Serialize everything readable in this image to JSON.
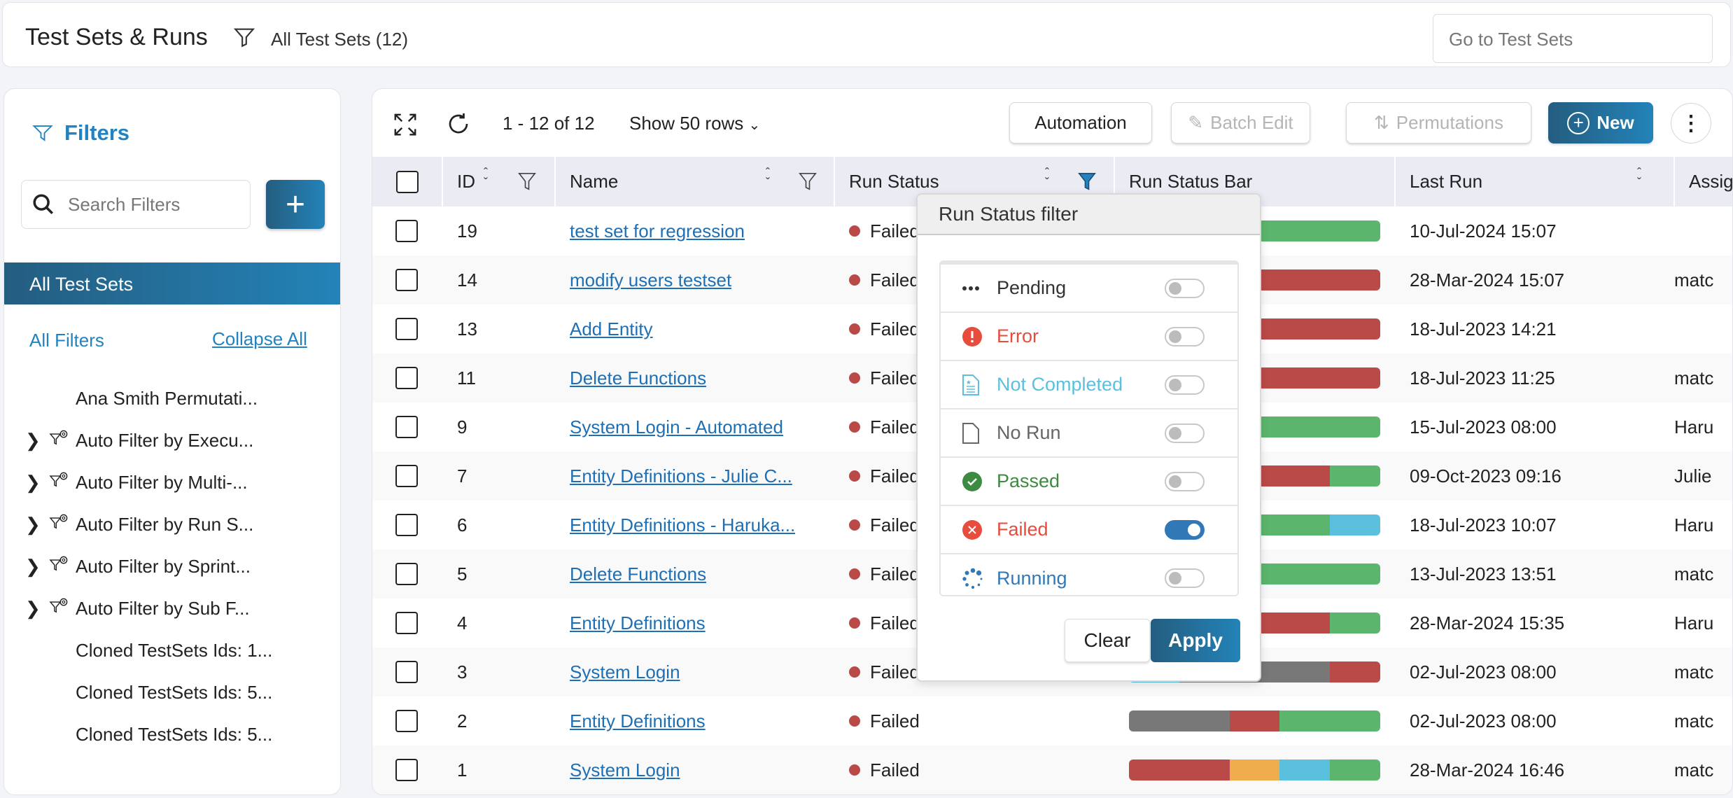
{
  "header": {
    "title": "Test Sets & Runs",
    "filter_label": "All Test Sets (12)",
    "goto_placeholder": "Go to Test Sets"
  },
  "sidebar": {
    "title": "Filters",
    "search_placeholder": "Search Filters",
    "add_label": "+",
    "selected": "All Test Sets",
    "all_filters": "All Filters",
    "collapse_all": "Collapse All",
    "items": [
      {
        "label": "Ana Smith Permutati...",
        "expandable": false,
        "auto": false
      },
      {
        "label": "Auto Filter by Execu...",
        "expandable": true,
        "auto": true
      },
      {
        "label": "Auto Filter by Multi-...",
        "expandable": true,
        "auto": true
      },
      {
        "label": "Auto Filter by Run S...",
        "expandable": true,
        "auto": true
      },
      {
        "label": "Auto Filter by Sprint...",
        "expandable": true,
        "auto": true
      },
      {
        "label": "Auto Filter by Sub F...",
        "expandable": true,
        "auto": true
      },
      {
        "label": "Cloned TestSets Ids: 1...",
        "expandable": false,
        "auto": false
      },
      {
        "label": "Cloned TestSets Ids: 5...",
        "expandable": false,
        "auto": false
      },
      {
        "label": "Cloned TestSets Ids: 5...",
        "expandable": false,
        "auto": false
      }
    ]
  },
  "toolbar": {
    "range": "1 - 12 of 12",
    "rows": "Show 50 rows",
    "automation": "Automation",
    "batch_edit": "Batch Edit",
    "permutations": "Permutations",
    "new": "New"
  },
  "colors": {
    "passed": "#5bb56d",
    "failed": "#b94a48",
    "norun": "#787878",
    "notcompleted": "#5bc0de",
    "error": "#f0ad4e",
    "accent": "#2383b8"
  },
  "table": {
    "columns": [
      "ID",
      "Name",
      "Run Status",
      "Run Status Bar",
      "Last Run",
      "Assig"
    ],
    "rows": [
      {
        "id": "19",
        "name": "test set for regression",
        "status": "Failed",
        "bar": [
          [
            "passed",
            5
          ]
        ],
        "last_run": "10-Jul-2024 15:07",
        "assigned": ""
      },
      {
        "id": "14",
        "name": "modify users testset",
        "status": "Failed",
        "bar": [
          [
            "failed",
            5
          ]
        ],
        "last_run": "28-Mar-2024 15:07",
        "assigned": "matc"
      },
      {
        "id": "13",
        "name": "Add Entity",
        "status": "Failed",
        "bar": [
          [
            "failed",
            5
          ]
        ],
        "last_run": "18-Jul-2023 14:21",
        "assigned": ""
      },
      {
        "id": "11",
        "name": "Delete Functions",
        "status": "Failed",
        "bar": [
          [
            "failed",
            5
          ]
        ],
        "last_run": "18-Jul-2023 11:25",
        "assigned": "matc"
      },
      {
        "id": "9",
        "name": "System Login - Automated",
        "status": "Failed",
        "bar": [
          [
            "passed",
            5
          ]
        ],
        "last_run": "15-Jul-2023 08:00",
        "assigned": "Haru"
      },
      {
        "id": "7",
        "name": "Entity Definitions - Julie C...",
        "status": "Failed",
        "bar": [
          [
            "failed",
            4
          ],
          [
            "passed",
            1
          ]
        ],
        "last_run": "09-Oct-2023 09:16",
        "assigned": "Julie"
      },
      {
        "id": "6",
        "name": "Entity Definitions - Haruka...",
        "status": "Failed",
        "bar": [
          [
            "passed",
            4
          ],
          [
            "notcompleted",
            1
          ]
        ],
        "last_run": "18-Jul-2023 10:07",
        "assigned": "Haru"
      },
      {
        "id": "5",
        "name": "Delete Functions",
        "status": "Failed",
        "bar": [
          [
            "passed",
            5
          ]
        ],
        "last_run": "13-Jul-2023 13:51",
        "assigned": "matc"
      },
      {
        "id": "4",
        "name": "Entity Definitions",
        "status": "Failed",
        "bar": [
          [
            "failed",
            4
          ],
          [
            "passed",
            1
          ]
        ],
        "last_run": "28-Mar-2024 15:35",
        "assigned": "Haru"
      },
      {
        "id": "3",
        "name": "System Login",
        "status": "Failed",
        "bar": [
          [
            "notcompleted",
            1
          ],
          [
            "norun",
            3
          ],
          [
            "failed",
            1
          ]
        ],
        "last_run": "02-Jul-2023 08:00",
        "assigned": "matc"
      },
      {
        "id": "2",
        "name": "Entity Definitions",
        "status": "Failed",
        "bar": [
          [
            "norun",
            2
          ],
          [
            "failed",
            1
          ],
          [
            "passed",
            2
          ]
        ],
        "last_run": "02-Jul-2023 08:00",
        "assigned": "matc"
      },
      {
        "id": "1",
        "name": "System Login",
        "status": "Failed",
        "bar": [
          [
            "failed",
            2
          ],
          [
            "error",
            1
          ],
          [
            "notcompleted",
            1
          ],
          [
            "passed",
            1
          ]
        ],
        "last_run": "28-Mar-2024 16:46",
        "assigned": "matc"
      }
    ]
  },
  "popup": {
    "title": "Run Status filter",
    "clear": "Clear",
    "apply": "Apply",
    "options": [
      {
        "label": "Pending",
        "icon": "ellipsis-icon",
        "color": "#333333",
        "on": false
      },
      {
        "label": "Error",
        "icon": "exclamation-circle-icon",
        "color": "#e74c3c",
        "on": false
      },
      {
        "label": "Not Completed",
        "icon": "document-star-icon",
        "color": "#5bc0de",
        "on": false
      },
      {
        "label": "No Run",
        "icon": "blank-document-icon",
        "color": "#666666",
        "on": false
      },
      {
        "label": "Passed",
        "icon": "check-circle-icon",
        "color": "#3d8b40",
        "on": false
      },
      {
        "label": "Failed",
        "icon": "x-circle-icon",
        "color": "#e74c3c",
        "on": true
      },
      {
        "label": "Running",
        "icon": "spinner-icon",
        "color": "#3178b7",
        "on": false
      }
    ]
  }
}
